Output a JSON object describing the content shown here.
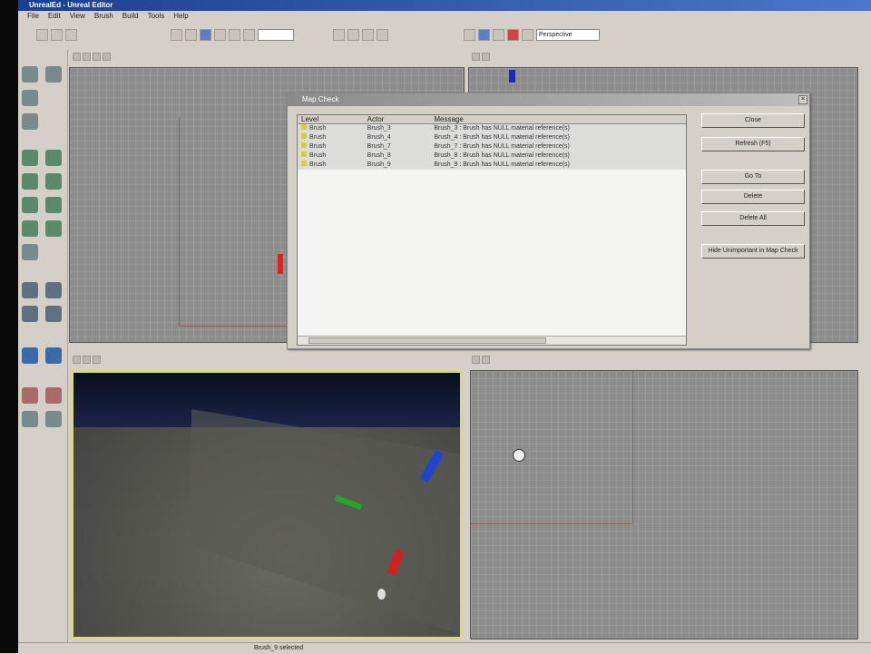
{
  "window": {
    "title": "UnrealEd - Unreal Editor"
  },
  "menu": [
    "File",
    "Edit",
    "View",
    "Brush",
    "Build",
    "Tools",
    "Help"
  ],
  "toolbar": {
    "camera_speed": "Perspective"
  },
  "dialog": {
    "title": "Map Check",
    "columns": [
      "Level",
      "Actor",
      "Message"
    ],
    "rows": [
      {
        "level": "Brush",
        "actor": "Brush_3",
        "message": "Brush_3 : Brush has NULL material reference(s)"
      },
      {
        "level": "Brush",
        "actor": "Brush_4",
        "message": "Brush_4 : Brush has NULL material reference(s)"
      },
      {
        "level": "Brush",
        "actor": "Brush_7",
        "message": "Brush_7 : Brush has NULL material reference(s)"
      },
      {
        "level": "Brush",
        "actor": "Brush_8",
        "message": "Brush_8 : Brush has NULL material reference(s)"
      },
      {
        "level": "Brush",
        "actor": "Brush_9",
        "message": "Brush_9 : Brush has NULL material reference(s)"
      }
    ],
    "buttons": {
      "close": "Close",
      "refresh": "Refresh (F5)",
      "goto": "Go To",
      "delete": "Delete",
      "delete_all": "Delete All",
      "last": "Hide Unimportant in Map Check"
    }
  },
  "status": {
    "text": "Brush_9 selected"
  },
  "colors": {
    "title": "#1b3f8f",
    "persp_border": "#d8d88a"
  }
}
